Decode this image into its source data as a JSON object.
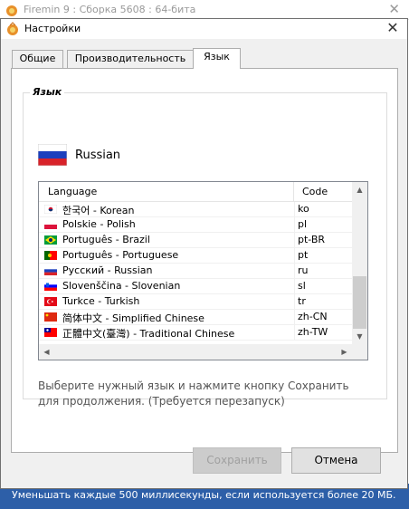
{
  "background_window": {
    "title": "Firemin 9 : Сборка 5608 : 64-бита",
    "status_text": "Уменьшать каждые 500 миллисекунды, если используется более 20 МБ."
  },
  "dialog": {
    "title": "Настройки",
    "tabs": [
      {
        "label": "Общие"
      },
      {
        "label": "Производительность"
      },
      {
        "label": "Язык"
      }
    ],
    "group_title": "Язык",
    "current_language": "Russian",
    "list": {
      "columns": {
        "language": "Language",
        "code": "Code"
      },
      "rows": [
        {
          "name": "한국어 - Korean",
          "code": "ko",
          "flag": "kr"
        },
        {
          "name": "Polskie - Polish",
          "code": "pl",
          "flag": "pl"
        },
        {
          "name": "Português - Brazil",
          "code": "pt-BR",
          "flag": "br"
        },
        {
          "name": "Português - Portuguese",
          "code": "pt",
          "flag": "pt"
        },
        {
          "name": "Русский - Russian",
          "code": "ru",
          "flag": "ru"
        },
        {
          "name": "Slovenščina - Slovenian",
          "code": "sl",
          "flag": "si"
        },
        {
          "name": "Turkce - Turkish",
          "code": "tr",
          "flag": "tr"
        },
        {
          "name": "简体中文 - Simplified Chinese",
          "code": "zh-CN",
          "flag": "cn"
        },
        {
          "name": "正體中文(臺灣) - Traditional Chinese",
          "code": "zh-TW",
          "flag": "tw"
        }
      ]
    },
    "hint": "Выберите нужный язык и нажмите кнопку Сохранить для продолжения. (Требуется перезапуск)",
    "buttons": {
      "save": "Сохранить",
      "cancel": "Отмена"
    }
  }
}
